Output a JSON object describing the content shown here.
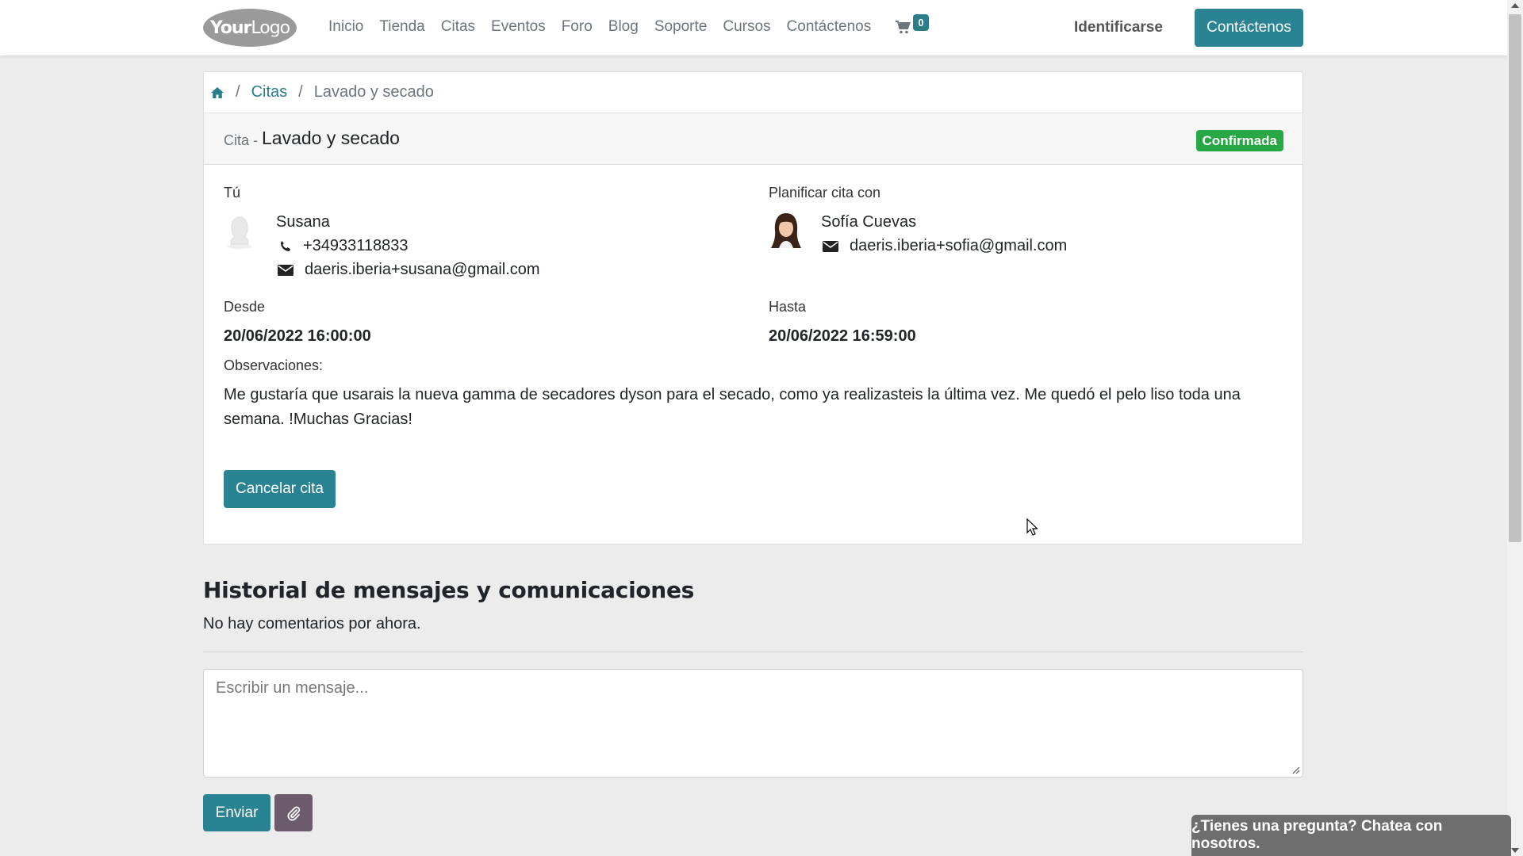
{
  "header": {
    "logo": "YourLogo",
    "logo_bold": "Your",
    "logo_light": "Logo",
    "nav": [
      "Inicio",
      "Tienda",
      "Citas",
      "Eventos",
      "Foro",
      "Blog",
      "Soporte",
      "Cursos",
      "Contáctenos"
    ],
    "cart_count": "0",
    "signin_label": "Identificarse",
    "contact_button": "Contáctenos"
  },
  "breadcrumb": {
    "home_icon": "home-icon",
    "items": [
      "Citas",
      "Lavado y secado"
    ]
  },
  "appointment": {
    "prefix": "Cita -",
    "title": "Lavado y secado",
    "status": "Confirmada",
    "status_color": "#28a745",
    "you_label": "Tú",
    "customer": {
      "name": "Susana",
      "phone": "+34933118833",
      "email": "daeris.iberia+susana@gmail.com"
    },
    "with_label": "Planificar cita con",
    "staff": {
      "name": "Sofía Cuevas",
      "email": "daeris.iberia+sofia@gmail.com"
    },
    "from_label": "Desde",
    "from_value": "20/06/2022 16:00:00",
    "to_label": "Hasta",
    "to_value": "20/06/2022 16:59:00",
    "notes_label": "Observaciones:",
    "notes": "Me gustaría que usarais la nueva gamma de secadores dyson para el secado, como ya realizasteis la última vez. Me quedó el pelo liso toda una semana. !Muchas Gracias!",
    "cancel_button": "Cancelar cita"
  },
  "history": {
    "title": "Historial de mensajes y comunicaciones",
    "empty": "No hay comentarios por ahora.",
    "placeholder": "Escribir un mensaje...",
    "send_button": "Enviar"
  },
  "chat_widget": "¿Tienes una pregunta? Chatea con nosotros.",
  "colors": {
    "primary": "#2a8393",
    "link": "#2a7d89",
    "attach_button": "#6b5b6b"
  }
}
